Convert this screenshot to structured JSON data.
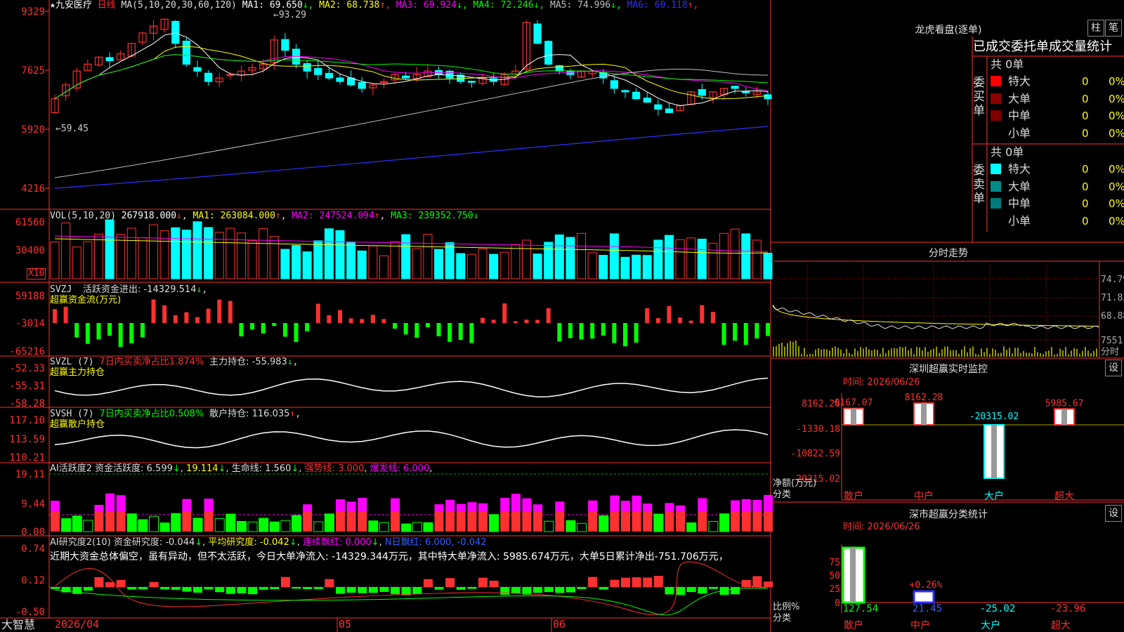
{
  "app": {
    "brand": "大智慧"
  },
  "stock": {
    "name": "九安医疗",
    "period": "日线",
    "star": "★"
  },
  "ma_header": {
    "label": "MA(5,10,20,30,60,120)",
    "items": [
      {
        "name": "MA1",
        "value": "69.650",
        "arrow": "↓",
        "color": "#ffffff"
      },
      {
        "name": "MA2",
        "value": "68.738",
        "arrow": "↑",
        "color": "#ffff00"
      },
      {
        "name": "MA3",
        "value": "69.924",
        "arrow": "↓",
        "color": "#ff00ff"
      },
      {
        "name": "MA4",
        "value": "72.246",
        "arrow": "↓",
        "color": "#00ff00"
      },
      {
        "name": "MA5",
        "value": "74.996",
        "arrow": "↓",
        "color": "#c0c0c0"
      },
      {
        "name": "MA6",
        "value": "60.118",
        "arrow": "↑",
        "color": "#3030ff"
      }
    ]
  },
  "price_axis": [
    "9329",
    "7625",
    "5920",
    "4216"
  ],
  "price_annotations": {
    "high": "93.29",
    "low": "59.45"
  },
  "vol_header": {
    "label": "VOL(5,10,20)",
    "value": "267918.000",
    "ma1": "MA1: 263084.000",
    "ma2": "MA2: 247524.094",
    "ma3": "MA3: 239352.750"
  },
  "vol_axis": [
    "61560",
    "30400"
  ],
  "vol_unit": "X10",
  "svzj": {
    "label": "SVZJ",
    "desc": "活跃资金进出: -14329.514",
    "name": "超赢资金流(万元)",
    "axis": [
      "59188",
      "-3014",
      "-65216"
    ]
  },
  "svzl": {
    "label": "SVZL (7)",
    "desc": "7日内买卖净占比1.874%",
    "extra": "主力持仓: -55.983",
    "name": "超赢主力持仓",
    "axis": [
      "-52.33",
      "-55.31",
      "-58.28"
    ]
  },
  "svsh": {
    "label": "SVSH (7)",
    "desc": "7日内买卖净占比0.508%",
    "extra": "散户持仓: 116.035",
    "name": "超赢散户持仓",
    "axis": [
      "117.10",
      "113.59",
      "110.21"
    ]
  },
  "ai_active": {
    "label": "AI活跃度2",
    "desc": "资金活跃度: 6.599",
    "v2": "19.114",
    "life": "生命线: 1.560",
    "strong": "强势线: 3.000",
    "burst": "爆发线: 6.000",
    "axis": [
      "19.11",
      "9.44",
      "0.00"
    ]
  },
  "ai_research": {
    "label": "AI研究度2(10)",
    "desc": "资金研究度: -0.044",
    "avg": "平均研究度: -0.042",
    "red": "连续飘红: 0.000",
    "nred": "N日飘红: 6.000, -0.042",
    "summary": "近期大资金总体偏空，虽有异动，但不太活跃，今日大单净流入: -14329.344万元，其中特大单净流入: 5985.674万元，大单5日累计净出-751.706万元，",
    "axis": [
      "0.74",
      "0.12",
      "-0.50"
    ]
  },
  "date_axis": [
    "2026/04",
    "05",
    "06"
  ],
  "right": {
    "lhb_title": "龙虎看盘(逐单)",
    "btn_bar": "柱",
    "btn_pen": "笔",
    "table_title": "已成交委托单成交量统计",
    "buy": {
      "side": "委买单",
      "total": "共 0单",
      "rows": [
        {
          "label": "特大",
          "count": "0",
          "pct": "0%",
          "color": "#ff0000"
        },
        {
          "label": "大单",
          "count": "0",
          "pct": "0%",
          "color": "#8b0000"
        },
        {
          "label": "中单",
          "count": "0",
          "pct": "0%",
          "color": "#800000"
        },
        {
          "label": "小单",
          "count": "0",
          "pct": "0%",
          "color": ""
        }
      ]
    },
    "sell": {
      "side": "委卖单",
      "total": "共 0单",
      "rows": [
        {
          "label": "特大",
          "count": "0",
          "pct": "0%",
          "color": "#00ffff"
        },
        {
          "label": "大单",
          "count": "0",
          "pct": "0%",
          "color": "#008b8b"
        },
        {
          "label": "中单",
          "count": "0",
          "pct": "0%",
          "color": "#007b7b"
        },
        {
          "label": "小单",
          "count": "0",
          "pct": "0%",
          "color": ""
        }
      ]
    },
    "intraday_title": "分时走势",
    "intraday_axis": [
      "74.79",
      "71.83",
      "68.88",
      "7551",
      "分时"
    ],
    "sz_monitor": {
      "title": "深圳超赢实时监控",
      "btn": "设",
      "time": "时间: 2026/06/26",
      "axis": [
        "8162.28",
        "-1330.18",
        "-10822.59",
        "-20315.02"
      ],
      "unit": "净额(万元)",
      "cat_label": "分类",
      "categories": [
        "散户",
        "中户",
        "大户",
        "超大"
      ],
      "values": [
        6167.07,
        8162.28,
        -20315.02,
        5985.67
      ],
      "labels": [
        "6167.07",
        "8162.28",
        "-20315.02",
        "5985.67"
      ]
    },
    "sz_class": {
      "title": "深市超赢分类统计",
      "btn": "设",
      "time": "时间: 2026/06/26",
      "axis": [
        "75",
        "50",
        "25",
        "0"
      ],
      "unit": "比例%",
      "cat_label": "分类",
      "categories": [
        "散户",
        "中户",
        "大户",
        "超大"
      ],
      "values": [
        127.54,
        21.45,
        -25.02,
        -23.96
      ],
      "labels": [
        "127.54",
        "21.45",
        "-25.02",
        "-23.96"
      ],
      "annotation": "+0.26%"
    }
  },
  "chart_data": [
    {
      "type": "candlestick",
      "title": "九安医疗 日线",
      "x": [
        "2026/04",
        "05",
        "06"
      ],
      "ylim": [
        42.16,
        93.29
      ],
      "series": [
        {
          "name": "close",
          "values": [
            68,
            72,
            76,
            78,
            80,
            79,
            81,
            84,
            87,
            89,
            91,
            84,
            78,
            76,
            73,
            74,
            75,
            76,
            77,
            78,
            85,
            82,
            78,
            76,
            75,
            74,
            73,
            72,
            71,
            72,
            73,
            75,
            74,
            75,
            76,
            75,
            74,
            73,
            73,
            74,
            73,
            75,
            76,
            90,
            84,
            78,
            76,
            75,
            76,
            76,
            74,
            71,
            70,
            68,
            67,
            65,
            64,
            66,
            70,
            69,
            70,
            71,
            71,
            70,
            70,
            68
          ]
        },
        {
          "name": "MA1",
          "values": [
            69.65
          ]
        },
        {
          "name": "MA2",
          "values": [
            68.738
          ]
        },
        {
          "name": "MA3",
          "values": [
            69.924
          ]
        },
        {
          "name": "MA4",
          "values": [
            72.246
          ]
        },
        {
          "name": "MA5",
          "values": [
            74.996
          ]
        },
        {
          "name": "MA6",
          "values": [
            60.118
          ]
        }
      ]
    }
  ]
}
